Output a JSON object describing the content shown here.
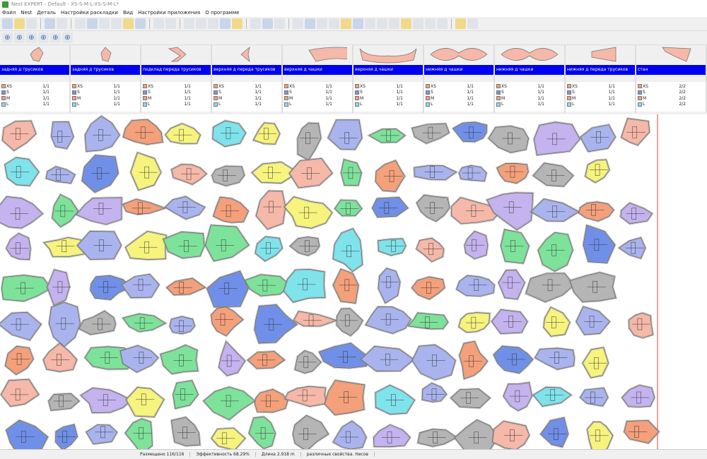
{
  "window": {
    "title": "Nest EXPERT - Default - XS-S-M-L-XS-S-M-L*"
  },
  "menu": [
    "Файл",
    "Nest",
    "Деталь",
    "Настройки раскладки",
    "Вид",
    "Настройки приложения",
    "О программе"
  ],
  "pieces": [
    {
      "name": "задняя д трусиков",
      "sizes": [
        [
          "XS",
          "1/1"
        ],
        [
          "S",
          "1/1"
        ],
        [
          "M",
          "1/1"
        ],
        [
          "L",
          "1/1"
        ]
      ]
    },
    {
      "name": "задняя д трусиков",
      "sizes": [
        [
          "XS",
          "1/1"
        ],
        [
          "S",
          "1/1"
        ],
        [
          "M",
          "1/1"
        ],
        [
          "L",
          "1/1"
        ]
      ]
    },
    {
      "name": "подклад переда трусиков",
      "sizes": [
        [
          "XS",
          "1/1"
        ],
        [
          "S",
          "1/1"
        ],
        [
          "M",
          "1/1"
        ],
        [
          "L",
          "1/1"
        ]
      ]
    },
    {
      "name": "верхняя д переда трусиков",
      "sizes": [
        [
          "XS",
          "1/1"
        ],
        [
          "S",
          "1/1"
        ],
        [
          "M",
          "1/1"
        ],
        [
          "L",
          "1/1"
        ]
      ]
    },
    {
      "name": "верхняя д чашки",
      "sizes": [
        [
          "XS",
          "1/1"
        ],
        [
          "S",
          "1/1"
        ],
        [
          "M",
          "1/1"
        ],
        [
          "L",
          "1/1"
        ]
      ]
    },
    {
      "name": "верхняя д чашки",
      "sizes": [
        [
          "XS",
          "1/1"
        ],
        [
          "S",
          "1/1"
        ],
        [
          "M",
          "1/1"
        ],
        [
          "L",
          "1/1"
        ]
      ]
    },
    {
      "name": "нижняя д чашки",
      "sizes": [
        [
          "XS",
          "1/1"
        ],
        [
          "S",
          "1/1"
        ],
        [
          "M",
          "1/1"
        ],
        [
          "L",
          "1/1"
        ]
      ]
    },
    {
      "name": "нижняя д чашки",
      "sizes": [
        [
          "XS",
          "1/1"
        ],
        [
          "S",
          "1/1"
        ],
        [
          "M",
          "1/1"
        ],
        [
          "L",
          "1/1"
        ]
      ]
    },
    {
      "name": "нижняя д переда трусиков",
      "sizes": [
        [
          "XS",
          "1/1"
        ],
        [
          "S",
          "1/1"
        ],
        [
          "M",
          "1/1"
        ],
        [
          "L",
          "1/1"
        ]
      ]
    },
    {
      "name": "стан",
      "sizes": [
        [
          "XS",
          "2/2"
        ],
        [
          "S",
          "2/2"
        ],
        [
          "M",
          "2/2"
        ],
        [
          "L",
          "2/2"
        ]
      ]
    }
  ],
  "size_colors": {
    "XS": "#f2a07a",
    "S": "#7b93e0",
    "M": "#f2a07a",
    "L": "#7fe3ec"
  },
  "status": {
    "placed": "Размещено 116/116",
    "efficiency": "Эффективность 68.29%",
    "length": "Длина 2.918 m",
    "props": "различные свойства. Несов"
  },
  "palette": [
    "#7de39a",
    "#a9b4ef",
    "#f4a07a",
    "#f7f47e",
    "#7fe3ec",
    "#f6b8a8",
    "#b5b5b5",
    "#c4b3ef",
    "#6f8fe8"
  ]
}
